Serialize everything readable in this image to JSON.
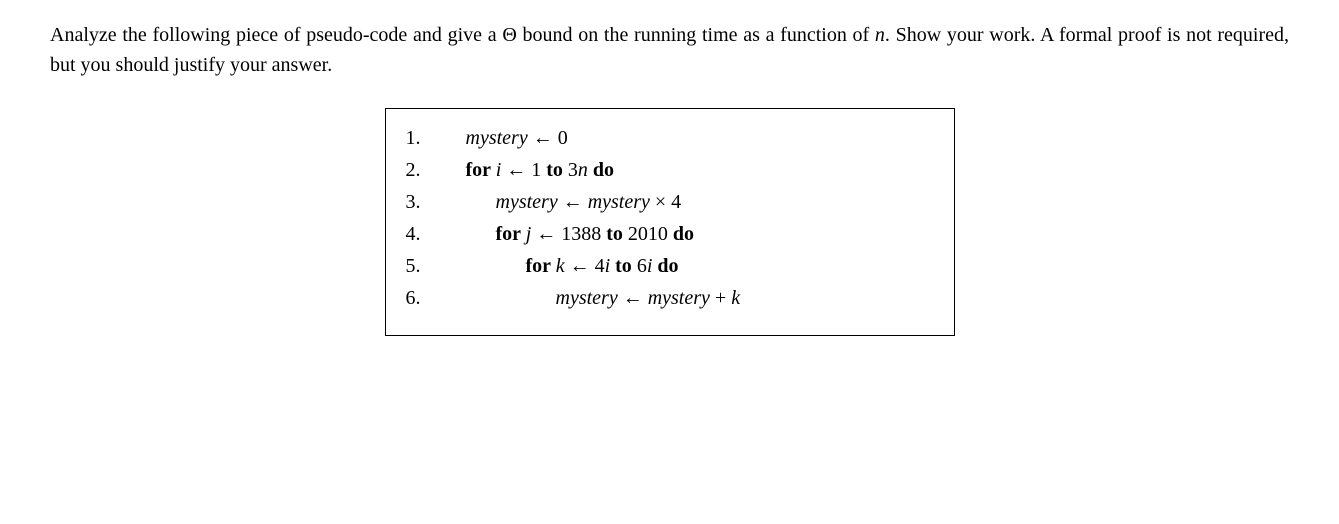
{
  "problem": {
    "text_before_theta": "Analyze the following piece of pseudo-code and give a ",
    "theta": "Θ",
    "text_after_theta": " bound on the running time as a function of ",
    "var_n": "n",
    "text_end": ". Show your work. A formal proof is not required, but you should justify your answer."
  },
  "code": {
    "lines": [
      {
        "num": "1.",
        "indent": 1,
        "parts": [
          {
            "t": "mystery",
            "cls": "italic"
          },
          {
            "t": " ← 0",
            "cls": ""
          }
        ]
      },
      {
        "num": "2.",
        "indent": 1,
        "parts": [
          {
            "t": "for ",
            "cls": "bold"
          },
          {
            "t": "i",
            "cls": "italic"
          },
          {
            "t": " ← 1 ",
            "cls": ""
          },
          {
            "t": "to",
            "cls": "bold"
          },
          {
            "t": " 3",
            "cls": ""
          },
          {
            "t": "n",
            "cls": "italic"
          },
          {
            "t": " ",
            "cls": ""
          },
          {
            "t": "do",
            "cls": "bold"
          }
        ]
      },
      {
        "num": "3.",
        "indent": 2,
        "parts": [
          {
            "t": "mystery",
            "cls": "italic"
          },
          {
            "t": " ← ",
            "cls": ""
          },
          {
            "t": "mystery",
            "cls": "italic"
          },
          {
            "t": " × 4",
            "cls": ""
          }
        ]
      },
      {
        "num": "4.",
        "indent": 2,
        "parts": [
          {
            "t": "for ",
            "cls": "bold"
          },
          {
            "t": "j",
            "cls": "italic"
          },
          {
            "t": " ← 1388 ",
            "cls": ""
          },
          {
            "t": "to",
            "cls": "bold"
          },
          {
            "t": " 2010 ",
            "cls": ""
          },
          {
            "t": "do",
            "cls": "bold"
          }
        ]
      },
      {
        "num": "5.",
        "indent": 3,
        "parts": [
          {
            "t": "for ",
            "cls": "bold"
          },
          {
            "t": "k",
            "cls": "italic"
          },
          {
            "t": " ← 4",
            "cls": ""
          },
          {
            "t": "i",
            "cls": "italic"
          },
          {
            "t": " ",
            "cls": ""
          },
          {
            "t": "to",
            "cls": "bold"
          },
          {
            "t": " 6",
            "cls": ""
          },
          {
            "t": "i",
            "cls": "italic"
          },
          {
            "t": " ",
            "cls": ""
          },
          {
            "t": "do",
            "cls": "bold"
          }
        ]
      },
      {
        "num": "6.",
        "indent": 4,
        "parts": [
          {
            "t": "mystery",
            "cls": "italic"
          },
          {
            "t": " ← ",
            "cls": ""
          },
          {
            "t": "mystery",
            "cls": "italic"
          },
          {
            "t": " + ",
            "cls": ""
          },
          {
            "t": "k",
            "cls": "italic"
          }
        ]
      }
    ]
  }
}
